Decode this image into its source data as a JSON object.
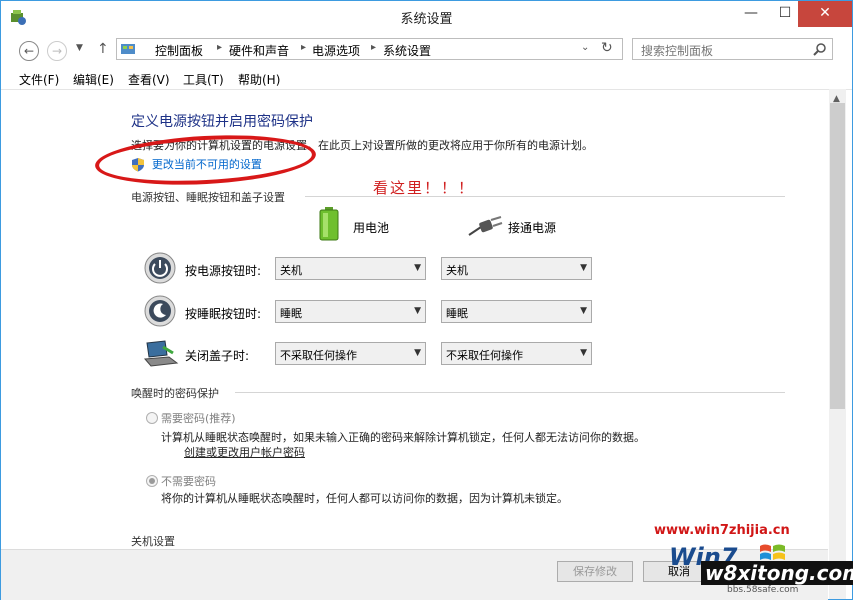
{
  "window": {
    "title": "系统设置",
    "min_glyph": "—",
    "max_glyph": "☐",
    "close_glyph": "✕"
  },
  "nav": {
    "back_glyph": "←",
    "forward_glyph": "→",
    "recent_glyph": "▼",
    "up_glyph": "↑",
    "breadcrumbs": [
      "控制面板",
      "硬件和声音",
      "电源选项",
      "系统设置"
    ],
    "sep_glyph": "▸",
    "dropdown_glyph": "⌄",
    "refresh_glyph": "↻",
    "search_placeholder": "搜索控制面板"
  },
  "menu": [
    "文件(F)",
    "编辑(E)",
    "查看(V)",
    "工具(T)",
    "帮助(H)"
  ],
  "page": {
    "title": "定义电源按钮并启用密码保护",
    "description": "选择要为你的计算机设置的电源设置。在此页上对设置所做的更改将应用于你所有的电源计划。",
    "change_link": "更改当前不可用的设置",
    "annotation": "看这里！！！",
    "section_buttons": "电源按钮、睡眠按钮和盖子设置",
    "col_battery": "用电池",
    "col_plugged": "接通电源",
    "rows": [
      {
        "label": "按电源按钮时:",
        "battery": "关机",
        "plugged": "关机"
      },
      {
        "label": "按睡眠按钮时:",
        "battery": "睡眠",
        "plugged": "睡眠"
      },
      {
        "label": "关闭盖子时:",
        "battery": "不采取任何操作",
        "plugged": "不采取任何操作"
      }
    ],
    "select_arrow": "▼",
    "section_password": "唤醒时的密码保护",
    "require_password": "需要密码(推荐)",
    "require_desc": "计算机从睡眠状态唤醒时，如果未输入正确的密码来解除计算机锁定，任何人都无法访问你的数据。",
    "account_link": "创建或更改用户帐户密码",
    "no_password": "不需要密码",
    "no_password_desc": "将你的计算机从睡眠状态唤醒时，任何人都可以访问你的数据，因为计算机未锁定。",
    "section_shutdown": "关机设置"
  },
  "footer": {
    "save": "保存修改",
    "cancel": "取消"
  },
  "watermark": {
    "site1": "www.win7zhijia.cn",
    "brand": "Win7",
    "site2": "w8xitong.com",
    "site3": "bbs.58safe.com"
  },
  "scroll": {
    "up_glyph": "▲"
  },
  "colors": {
    "title_blue": "#1e3287",
    "link_blue": "#0066cc",
    "annotation_red": "#d02020",
    "close_red": "#c7463d"
  }
}
